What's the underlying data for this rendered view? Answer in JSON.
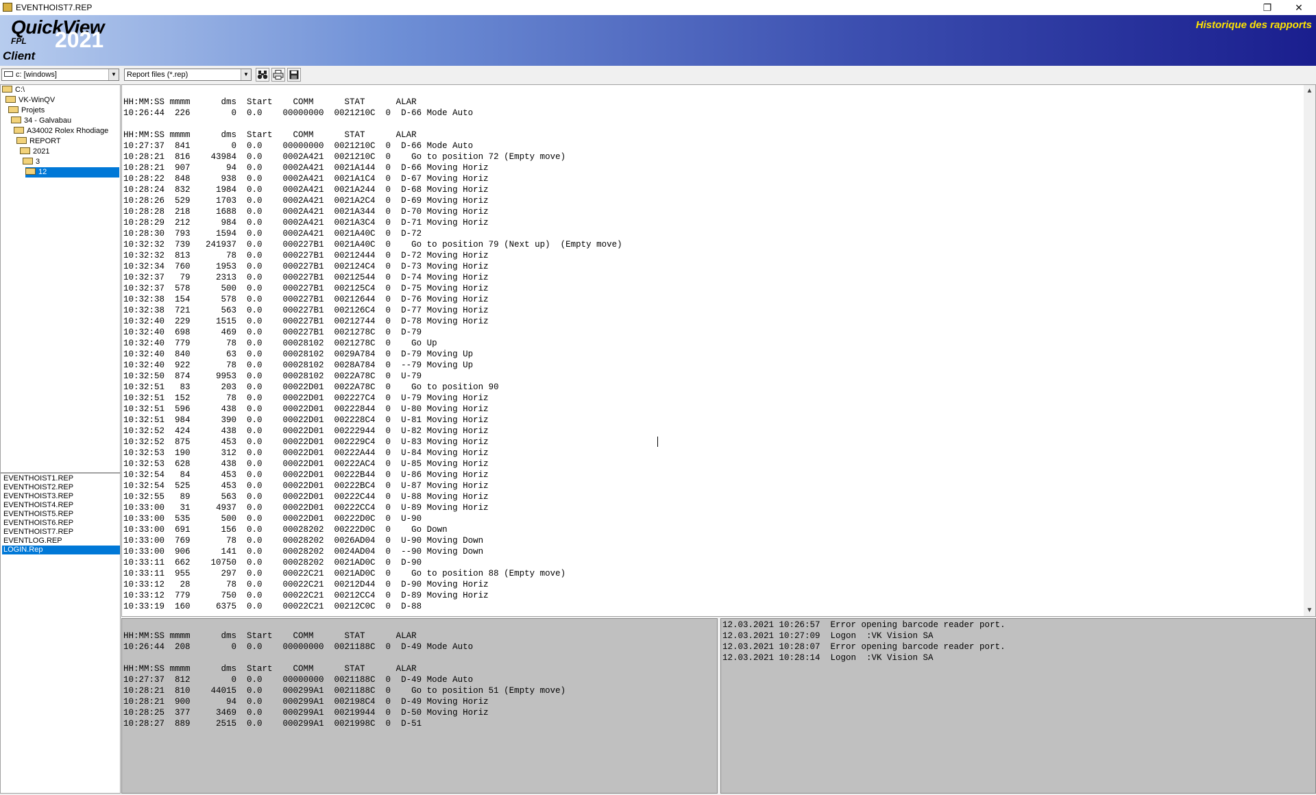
{
  "window": {
    "title": "EVENTHOIST7.REP"
  },
  "banner": {
    "logo_name": "QuickView",
    "logo_sub": "FPL",
    "logo_year": "2021",
    "logo_edition": "Client",
    "title": "Historique des rapports",
    "title_color": "#ffe400"
  },
  "toolbar": {
    "drive": "c: [windows]",
    "filter": "Report files (*.rep)",
    "icons": [
      "binoculars-icon",
      "print-icon",
      "save-icon"
    ]
  },
  "tree": {
    "items": [
      "C:\\",
      "VK-WinQV",
      "Projets",
      "34 - Galvabau",
      "A34002 Rolex Rhodiage",
      "REPORT",
      "2021",
      "3",
      "12"
    ],
    "selected": "12"
  },
  "files": {
    "items": [
      "EVENTHOIST1.REP",
      "EVENTHOIST2.REP",
      "EVENTHOIST3.REP",
      "EVENTHOIST4.REP",
      "EVENTHOIST5.REP",
      "EVENTHOIST6.REP",
      "EVENTHOIST7.REP",
      "EVENTLOG.REP",
      "LOGIN.Rep"
    ],
    "selected": "LOGIN.Rep"
  },
  "report": {
    "text": "HH:MM:SS mmmm      dms  Start    COMM      STAT      ALAR\n10:26:44  226        0  0.0    00000000  0021210C  0  D-66 Mode Auto\n\nHH:MM:SS mmmm      dms  Start    COMM      STAT      ALAR\n10:27:37  841        0  0.0    00000000  0021210C  0  D-66 Mode Auto\n10:28:21  816    43984  0.0    0002A421  0021210C  0    Go to position 72 (Empty move)\n10:28:21  907       94  0.0    0002A421  0021A144  0  D-66 Moving Horiz\n10:28:22  848      938  0.0    0002A421  0021A1C4  0  D-67 Moving Horiz\n10:28:24  832     1984  0.0    0002A421  0021A244  0  D-68 Moving Horiz\n10:28:26  529     1703  0.0    0002A421  0021A2C4  0  D-69 Moving Horiz\n10:28:28  218     1688  0.0    0002A421  0021A344  0  D-70 Moving Horiz\n10:28:29  212      984  0.0    0002A421  0021A3C4  0  D-71 Moving Horiz\n10:28:30  793     1594  0.0    0002A421  0021A40C  0  D-72\n10:32:32  739   241937  0.0    000227B1  0021A40C  0    Go to position 79 (Next up)  (Empty move)\n10:32:32  813       78  0.0    000227B1  00212444  0  D-72 Moving Horiz\n10:32:34  760     1953  0.0    000227B1  002124C4  0  D-73 Moving Horiz\n10:32:37   79     2313  0.0    000227B1  00212544  0  D-74 Moving Horiz\n10:32:37  578      500  0.0    000227B1  002125C4  0  D-75 Moving Horiz\n10:32:38  154      578  0.0    000227B1  00212644  0  D-76 Moving Horiz\n10:32:38  721      563  0.0    000227B1  002126C4  0  D-77 Moving Horiz\n10:32:40  229     1515  0.0    000227B1  00212744  0  D-78 Moving Horiz\n10:32:40  698      469  0.0    000227B1  0021278C  0  D-79\n10:32:40  779       78  0.0    00028102  0021278C  0    Go Up\n10:32:40  840       63  0.0    00028102  0029A784  0  D-79 Moving Up\n10:32:40  922       78  0.0    00028102  0028A784  0  --79 Moving Up\n10:32:50  874     9953  0.0    00028102  0022A78C  0  U-79\n10:32:51   83      203  0.0    00022D01  0022A78C  0    Go to position 90\n10:32:51  152       78  0.0    00022D01  002227C4  0  U-79 Moving Horiz\n10:32:51  596      438  0.0    00022D01  00222844  0  U-80 Moving Horiz\n10:32:51  984      390  0.0    00022D01  002228C4  0  U-81 Moving Horiz\n10:32:52  424      438  0.0    00022D01  00222944  0  U-82 Moving Horiz\n10:32:52  875      453  0.0    00022D01  002229C4  0  U-83 Moving Horiz\n10:32:53  190      312  0.0    00022D01  00222A44  0  U-84 Moving Horiz\n10:32:53  628      438  0.0    00022D01  00222AC4  0  U-85 Moving Horiz\n10:32:54   84      453  0.0    00022D01  00222B44  0  U-86 Moving Horiz\n10:32:54  525      453  0.0    00022D01  00222BC4  0  U-87 Moving Horiz\n10:32:55   89      563  0.0    00022D01  00222C44  0  U-88 Moving Horiz\n10:33:00   31     4937  0.0    00022D01  00222CC4  0  U-89 Moving Horiz\n10:33:00  535      500  0.0    00022D01  00222D0C  0  U-90\n10:33:00  691      156  0.0    00028202  00222D0C  0    Go Down\n10:33:00  769       78  0.0    00028202  0026AD04  0  U-90 Moving Down\n10:33:00  906      141  0.0    00028202  0024AD04  0  --90 Moving Down\n10:33:11  662    10750  0.0    00028202  0021AD0C  0  D-90\n10:33:11  955      297  0.0    00022C21  0021AD0C  0    Go to position 88 (Empty move)\n10:33:12   28       78  0.0    00022C21  00212D44  0  D-90 Moving Horiz\n10:33:12  779      750  0.0    00022C21  00212CC4  0  D-89 Moving Horiz\n10:33:19  160     6375  0.0    00022C21  00212C0C  0  D-88"
  },
  "history": {
    "text": "\nHH:MM:SS mmmm      dms  Start    COMM      STAT      ALAR\n10:26:44  208        0  0.0    00000000  0021188C  0  D-49 Mode Auto\n\nHH:MM:SS mmmm      dms  Start    COMM      STAT      ALAR\n10:27:37  812        0  0.0    00000000  0021188C  0  D-49 Mode Auto\n10:28:21  810    44015  0.0    000299A1  0021188C  0    Go to position 51 (Empty move)\n10:28:21  900       94  0.0    000299A1  002198C4  0  D-49 Moving Horiz\n10:28:25  377     3469  0.0    000299A1  00219944  0  D-50 Moving Horiz\n10:28:27  889     2515  0.0    000299A1  0021998C  0  D-51"
  },
  "events": {
    "text": "12.03.2021 10:26:57  Error opening barcode reader port.\n12.03.2021 10:27:09  Logon  :VK Vision SA\n12.03.2021 10:28:07  Error opening barcode reader port.\n12.03.2021 10:28:14  Logon  :VK Vision SA"
  }
}
